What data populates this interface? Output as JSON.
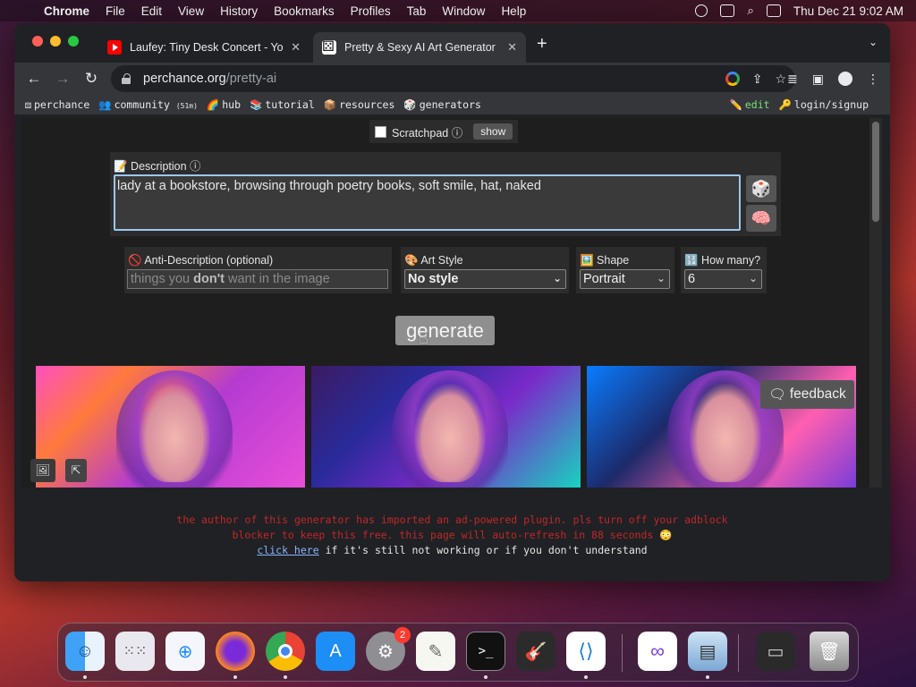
{
  "menubar": {
    "app_name": "Chrome",
    "items": [
      "File",
      "Edit",
      "View",
      "History",
      "Bookmarks",
      "Profiles",
      "Tab",
      "Window",
      "Help"
    ],
    "clock": "Thu Dec 21  9:02 AM"
  },
  "browser": {
    "tabs": [
      {
        "title": "Laufey: Tiny Desk Concert - Yo",
        "icon": "youtube-favicon"
      },
      {
        "title": "Pretty & Sexy AI Art Generator",
        "icon": "perchance-favicon"
      }
    ],
    "url_host": "perchance.org",
    "url_path": "/pretty-ai",
    "bookmarks": [
      {
        "emoji": "⚄",
        "label": "perchance",
        "suffix": ""
      },
      {
        "emoji": "👥",
        "label": "community",
        "suffix": "(51m)"
      },
      {
        "emoji": "🌈",
        "label": "hub",
        "suffix": ""
      },
      {
        "emoji": "📚",
        "label": "tutorial",
        "suffix": ""
      },
      {
        "emoji": "📦",
        "label": "resources",
        "suffix": ""
      },
      {
        "emoji": "🎲",
        "label": "generators",
        "suffix": ""
      }
    ],
    "bookmarks_right": [
      {
        "emoji": "✏️",
        "label": "edit"
      },
      {
        "emoji": "🔑",
        "label": "login/signup"
      }
    ]
  },
  "page": {
    "scratchpad": {
      "label": "Scratchpad ⓘ",
      "button": "show"
    },
    "description": {
      "label": "📝 Description ⓘ",
      "value": "lady at a bookstore, browsing through poetry books, soft smile, hat, naked"
    },
    "anti_description": {
      "label": "🚫 Anti-Description (optional)",
      "placeholder_pre": "things you ",
      "placeholder_bold": "don't",
      "placeholder_post": " want in the image"
    },
    "art_style": {
      "label": "🎨 Art Style",
      "value": "No style"
    },
    "shape": {
      "label": "🖼️ Shape",
      "value": "Portrait"
    },
    "how_many": {
      "label": "🔢 How many?",
      "value": "6"
    },
    "generate_label": "generate",
    "feedback_label": "feedback",
    "adblock_notice": {
      "line1": "the author of this generator has imported an ad-powered plugin. pls turn off your adblock",
      "line2": "blocker to keep this free. this page will auto-refresh in 88 seconds 😳",
      "link_text": "click here",
      "line3_rest": " if it's still not working or if you don't understand"
    }
  },
  "dock": {
    "apps": [
      "finder",
      "launchpad",
      "safari",
      "firefox",
      "chrome",
      "app-store",
      "system-settings",
      "textedit",
      "terminal",
      "garageband",
      "vscode",
      "visual-studio",
      "preview",
      "screenshot",
      "trash"
    ],
    "system_settings_badge": "2"
  }
}
